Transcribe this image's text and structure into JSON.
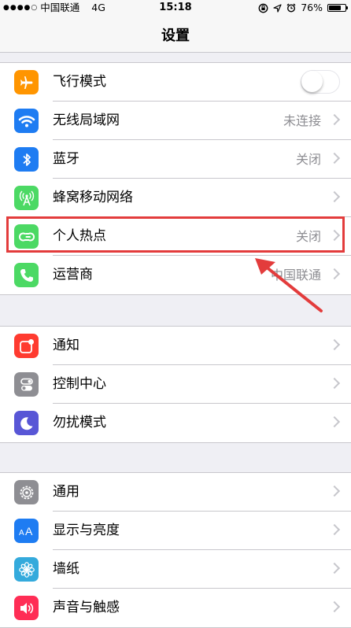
{
  "status_bar": {
    "signal": "●●●●○",
    "carrier": "中国联通",
    "network": "4G",
    "time": "15:18",
    "battery_percent": "76%",
    "battery_level": 0.76
  },
  "nav": {
    "title": "设置"
  },
  "groups": [
    {
      "rows": [
        {
          "label": "飞行模式",
          "value": "",
          "icon": "airplane-icon",
          "color": "#ff9500",
          "toggle": true,
          "toggle_on": false
        },
        {
          "label": "无线局域网",
          "value": "未连接",
          "icon": "wifi-icon",
          "color": "#1e7cf2"
        },
        {
          "label": "蓝牙",
          "value": "关闭",
          "icon": "bluetooth-icon",
          "color": "#1e7cf2"
        },
        {
          "label": "蜂窝移动网络",
          "value": "",
          "icon": "cellular-icon",
          "color": "#4cd964"
        },
        {
          "label": "个人热点",
          "value": "关闭",
          "icon": "hotspot-icon",
          "color": "#4cd964"
        },
        {
          "label": "运营商",
          "value": "中国联通",
          "icon": "phone-icon",
          "color": "#4cd964"
        }
      ]
    },
    {
      "rows": [
        {
          "label": "通知",
          "value": "",
          "icon": "notifications-icon",
          "color": "#ff3b30"
        },
        {
          "label": "控制中心",
          "value": "",
          "icon": "control-center-icon",
          "color": "#8e8e93"
        },
        {
          "label": "勿扰模式",
          "value": "",
          "icon": "moon-icon",
          "color": "#5856d6"
        }
      ]
    },
    {
      "rows": [
        {
          "label": "通用",
          "value": "",
          "icon": "gear-icon",
          "color": "#8e8e93"
        },
        {
          "label": "显示与亮度",
          "value": "",
          "icon": "display-icon",
          "color": "#1e7cf2"
        },
        {
          "label": "墙纸",
          "value": "",
          "icon": "flower-icon",
          "color": "#34aadc"
        },
        {
          "label": "声音与触感",
          "value": "",
          "icon": "speaker-icon",
          "color": "#ff2d55"
        }
      ]
    }
  ],
  "annotation": {
    "highlight_color": "#e33c3c"
  }
}
